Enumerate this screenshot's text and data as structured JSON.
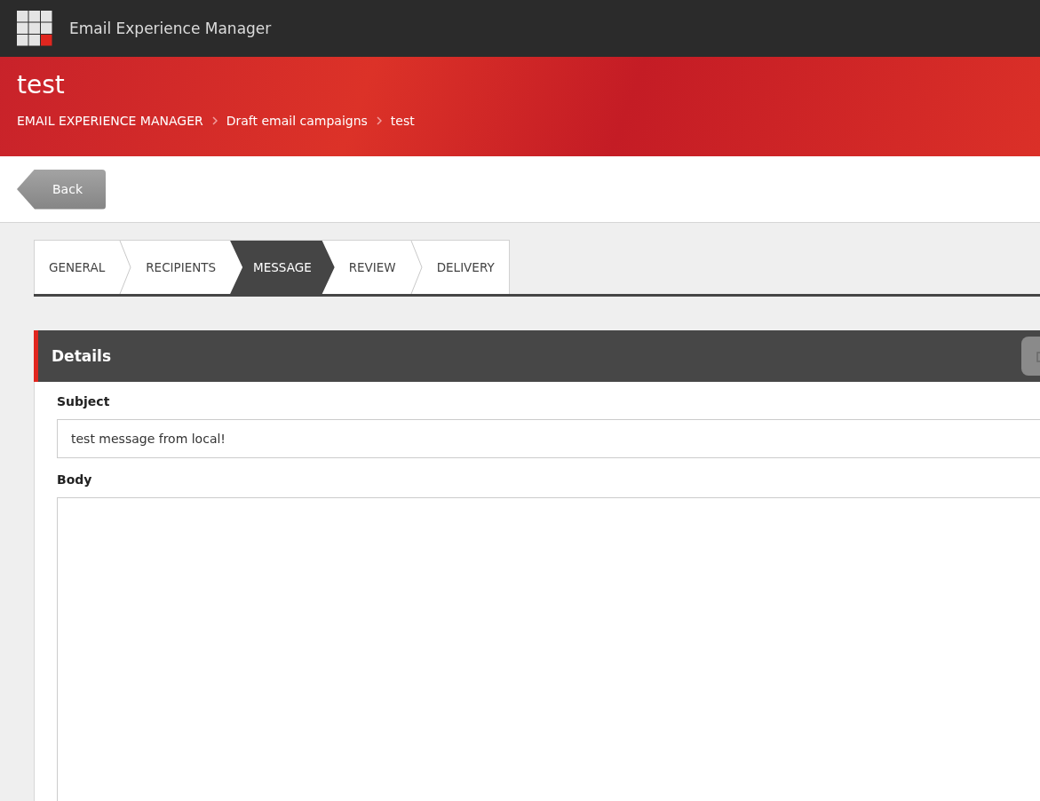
{
  "app_bar": {
    "title": "Email Experience Manager"
  },
  "header": {
    "title": "test",
    "breadcrumb": [
      "EMAIL EXPERIENCE MANAGER",
      "Draft email campaigns",
      "test"
    ]
  },
  "toolbar": {
    "back_button": "Back"
  },
  "tabs": [
    {
      "label": "GENERAL",
      "selected": false
    },
    {
      "label": "RECIPIENTS",
      "selected": false
    },
    {
      "label": "MESSAGE",
      "selected": true
    },
    {
      "label": "REVIEW",
      "selected": false
    },
    {
      "label": "DELIVERY",
      "selected": false
    }
  ],
  "panel": {
    "title": "Details",
    "fields": [
      {
        "label": "Subject",
        "kind": "input",
        "value": "test message from local!"
      },
      {
        "label": "Body",
        "kind": "textarea"
      }
    ]
  }
}
